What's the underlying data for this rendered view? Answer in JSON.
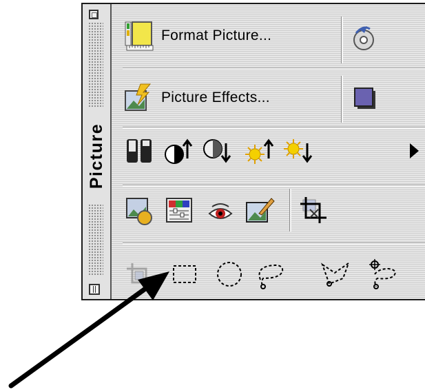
{
  "palette": {
    "title": "Picture",
    "rows": {
      "row1": {
        "format_picture_label": "Format Picture..."
      },
      "row2": {
        "picture_effects_label": "Picture Effects..."
      }
    },
    "icons": [
      "format-picture-icon",
      "rotate-icon",
      "picture-effects-icon",
      "shadow-icon",
      "color-mode-icon",
      "more-contrast-icon",
      "less-contrast-icon",
      "more-brightness-icon",
      "less-brightness-icon",
      "more-arrow-icon",
      "set-transparent-color-icon",
      "color-adjust-icon",
      "red-eye-icon",
      "fix-scratch-icon",
      "crop-icon",
      "select-icon",
      "rectangle-marquee-icon",
      "oval-marquee-icon",
      "lasso-icon",
      "polygon-lasso-icon",
      "magic-lasso-icon"
    ]
  },
  "annotation": {
    "arrow_color": "#000000"
  }
}
